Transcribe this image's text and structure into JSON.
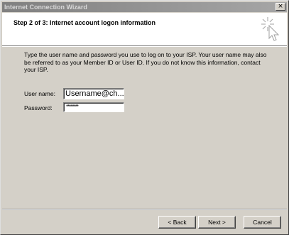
{
  "window": {
    "title": "Internet Connection Wizard",
    "close_glyph": "×"
  },
  "header": {
    "step_title": "Step 2 of 3: Internet account logon information",
    "icon": "wizard-sparkle-cursor-icon"
  },
  "body": {
    "instructions": "Type the user name and password you use to log on to your ISP. Your user name may also be referred to as your Member ID or User ID. If you do not know this information, contact your ISP."
  },
  "form": {
    "username_label": "User name:",
    "username_value": "Username@ch...",
    "password_label": "Password:",
    "password_value": "********"
  },
  "buttons": {
    "back": "< Back",
    "next": "Next >",
    "cancel": "Cancel"
  }
}
